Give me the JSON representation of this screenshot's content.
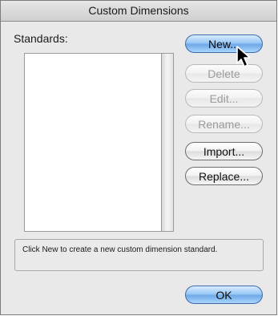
{
  "window": {
    "title": "Custom Dimensions"
  },
  "list": {
    "label": "Standards:",
    "items": []
  },
  "buttons": {
    "new": "New...",
    "delete": "Delete",
    "edit": "Edit...",
    "rename": "Rename...",
    "import": "Import...",
    "replace": "Replace...",
    "ok": "OK"
  },
  "status": {
    "message": "Click New to create a new custom dimension standard."
  },
  "colors": {
    "default_button": "#7fb6ee",
    "window_background": "#e9e9e9"
  }
}
